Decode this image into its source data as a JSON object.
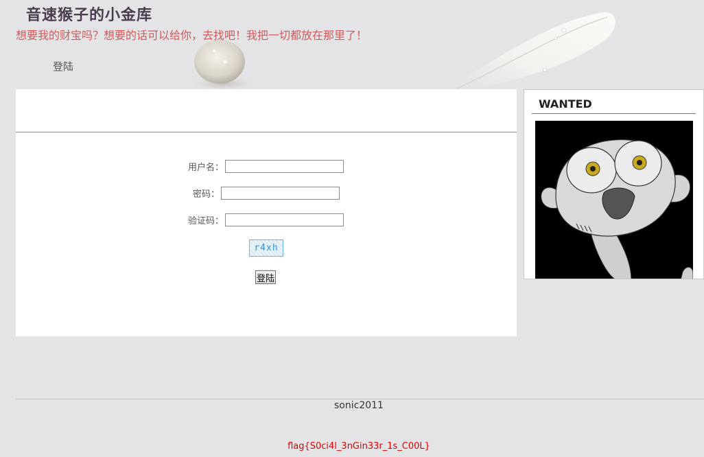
{
  "header": {
    "title": "音速猴子的小金库",
    "subtitle": "想要我的财宝吗？想要的话可以给你，去找吧！我把一切都放在那里了！"
  },
  "nav": {
    "login_label": "登陆"
  },
  "login_form": {
    "username_label": "用户名：",
    "username_value": "",
    "password_label": "密码：",
    "password_value": "",
    "captcha_label": "验证码：",
    "captcha_value": "",
    "captcha_image_text": "r4xh",
    "submit_label": "登陆"
  },
  "sidebar": {
    "title": "WANTED"
  },
  "footer": {
    "author": "sonic2011",
    "flag": "flag{S0ci4l_3nGin33r_1s_C00L}"
  },
  "colors": {
    "background": "#e4e4e6",
    "title": "#4a3b4e",
    "subtitle": "#d05a5a",
    "flag": "#e00000"
  }
}
